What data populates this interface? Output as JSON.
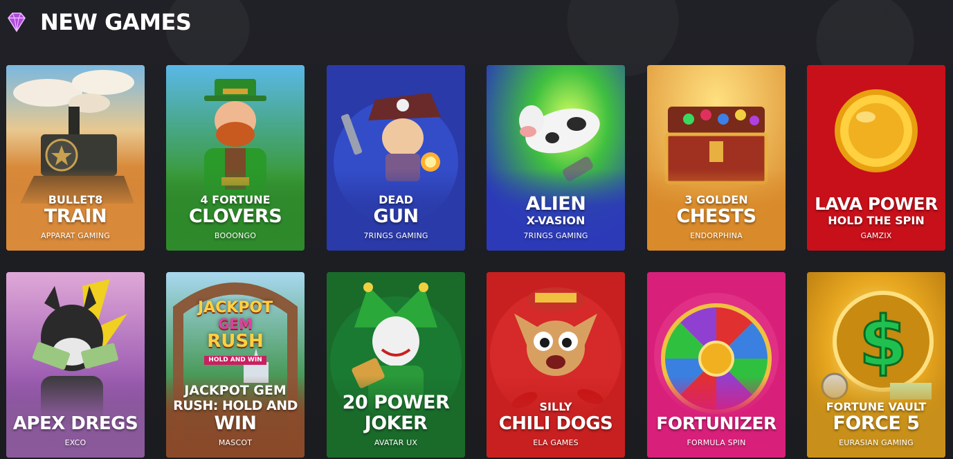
{
  "section": {
    "title": "NEW GAMES",
    "icon": "diamond-icon"
  },
  "games": [
    {
      "line1": "BULLET8",
      "line2": "TRAIN",
      "line3": "",
      "provider": "APPARAT GAMING",
      "bg": "#d98a3a",
      "art": "train"
    },
    {
      "line1": "4 FORTUNE",
      "line2": "CLOVERS",
      "line3": "",
      "provider": "BOOONGO",
      "bg": "#2e8a2a",
      "art": "leprechaun"
    },
    {
      "line1": "DEAD",
      "line2": "GUN",
      "line3": "",
      "provider": "7RINGS GAMING",
      "bg": "#2a3aa8",
      "art": "pirate"
    },
    {
      "line1": "",
      "line2": "ALIEN",
      "line3": "X-VASION",
      "provider": "7RINGS GAMING",
      "bg": "#2c3ab8",
      "art": "cow"
    },
    {
      "line1": "3 GOLDEN",
      "line2": "CHESTS",
      "line3": "",
      "provider": "ENDORPHINA",
      "bg": "#d98a2a",
      "art": "chest"
    },
    {
      "line1": "",
      "line2": "LAVA POWER",
      "line3": "HOLD THE SPIN",
      "provider": "GAMZIX",
      "bg": "#c8101a",
      "art": "coin"
    },
    {
      "line1": "",
      "line2": "APEX DREGS",
      "line3": "",
      "provider": "EXCO",
      "bg": "#8a5a9a",
      "art": "dog"
    },
    {
      "line1": "JACKPOT GEM",
      "line2": "RUSH: HOLD AND",
      "line3": "WIN",
      "provider": "MASCOT",
      "bg": "#8a4a2a",
      "art": "jackpot",
      "logo_lines": [
        "JACKPOT",
        "GEM",
        "RUSH",
        "HOLD AND WIN"
      ]
    },
    {
      "line1": "",
      "line2": "20 POWER",
      "line3": "JOKER",
      "provider": "AVATAR UX",
      "bg": "#1a6a2a",
      "art": "joker"
    },
    {
      "line1": "SILLY",
      "line2": "CHILI DOGS",
      "line3": "",
      "provider": "ELA GAMES",
      "bg": "#c82020",
      "art": "chihuahua"
    },
    {
      "line1": "",
      "line2": "FORTUNIZER",
      "line3": "",
      "provider": "FORMULA SPIN",
      "bg": "#d8207a",
      "art": "wheel"
    },
    {
      "line1": "FORTUNE VAULT",
      "line2": "FORCE 5",
      "line3": "",
      "provider": "EURASIAN GAMING",
      "bg": "#c8901a",
      "art": "dollar"
    }
  ]
}
